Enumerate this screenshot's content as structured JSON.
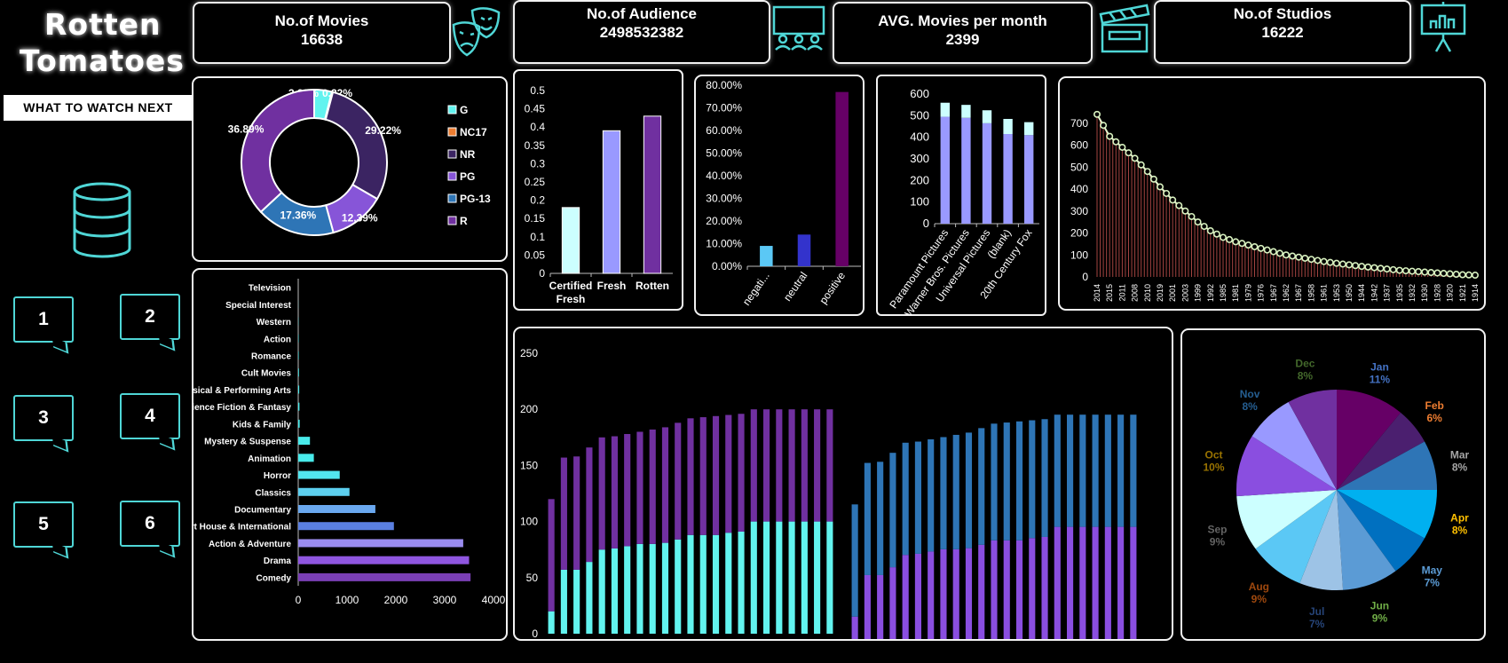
{
  "brand": {
    "line1": "Rotten",
    "line2": "Tomatoes",
    "tagline": "WHAT TO WATCH NEXT"
  },
  "kpis": [
    {
      "title": "No.of Movies",
      "value": "16638"
    },
    {
      "title": "No.of Audience",
      "value": "2498532382"
    },
    {
      "title": "AVG. Movies per month",
      "value": "2399"
    },
    {
      "title": "No.of Studios",
      "value": "16222"
    }
  ],
  "nav_buttons": [
    "1",
    "2",
    "3",
    "4",
    "5",
    "6"
  ],
  "colors": {
    "accent": "#4fd6d6",
    "panel_border": "#f2f2f2",
    "background": "#000000"
  },
  "icons": [
    "theater-masks-icon",
    "audience-icon",
    "clapperboard-icon",
    "presentation-icon",
    "database-icon"
  ],
  "chart_data": [
    {
      "type": "pie",
      "subtype": "donut",
      "categories": [
        "G",
        "NC17",
        "NR",
        "PG",
        "PG-13",
        "R"
      ],
      "values": [
        3.92,
        0.22,
        29.22,
        12.39,
        17.36,
        36.89
      ],
      "labels": [
        "3.92%",
        "0.22%",
        "29.22%",
        "12.39%",
        "17.36%",
        "36.89%"
      ],
      "colors": [
        "#62f3ef",
        "#ed7d31",
        "#3b2462",
        "#8755d8",
        "#2e75b6",
        "#7030a0"
      ],
      "legend": "right"
    },
    {
      "type": "bar",
      "categories": [
        "Certified Fresh",
        "Fresh",
        "Rotten"
      ],
      "values": [
        0.18,
        0.39,
        0.43
      ],
      "colors": [
        "#ccffff",
        "#9999ff",
        "#7030a0"
      ],
      "ylim": [
        0,
        0.5
      ],
      "yticks": [
        "0",
        "0.05",
        "0.1",
        "0.15",
        "0.2",
        "0.25",
        "0.3",
        "0.35",
        "0.4",
        "0.45",
        "0.5"
      ]
    },
    {
      "type": "bar",
      "categories": [
        "negati...",
        "neutral",
        "positive"
      ],
      "values": [
        9,
        14,
        77
      ],
      "colors": [
        "#5bc8f5",
        "#3333cc",
        "#660066"
      ],
      "ylim": [
        0,
        80
      ],
      "yticks": [
        "0.00%",
        "10.00%",
        "20.00%",
        "30.00%",
        "40.00%",
        "50.00%",
        "60.00%",
        "70.00%",
        "80.00%"
      ]
    },
    {
      "type": "bar",
      "stacked": true,
      "categories": [
        "Paramount Pictures",
        "Warner Bros. Pictures",
        "Universal Pictures",
        "(blank)",
        "20th Century Fox"
      ],
      "series": [
        {
          "values": [
            495,
            490,
            465,
            415,
            410
          ],
          "color": "#9999ff"
        },
        {
          "values": [
            65,
            60,
            60,
            70,
            60
          ],
          "color": "#ccffff"
        }
      ],
      "ylim": [
        0,
        600
      ],
      "yticks": [
        "0",
        "100",
        "200",
        "300",
        "400",
        "500",
        "600"
      ]
    },
    {
      "type": "line",
      "x": [
        "2014",
        "2015",
        "2011",
        "2008",
        "2010",
        "2019",
        "2001",
        "2003",
        "1999",
        "1992",
        "1985",
        "1981",
        "1979",
        "1976",
        "1967",
        "1962",
        "1967",
        "1958",
        "1961",
        "1953",
        "1950",
        "1944",
        "1942",
        "1937",
        "1935",
        "1932",
        "1930",
        "1928",
        "1920",
        "1921",
        "1914"
      ],
      "xticks": [
        "2014",
        "2015",
        "2011",
        "2008",
        "2010",
        "2019",
        "2001",
        "2003",
        "1999",
        "1992",
        "1985",
        "1981",
        "1979",
        "1976",
        "1967",
        "1962",
        "1967",
        "1958",
        "1961",
        "1953",
        "1950",
        "1944",
        "1942",
        "1937",
        "1935",
        "1932",
        "1930",
        "1928",
        "1920",
        "1921",
        "1914"
      ],
      "values": [
        740,
        640,
        590,
        540,
        480,
        410,
        350,
        300,
        250,
        210,
        180,
        160,
        145,
        130,
        115,
        100,
        90,
        80,
        70,
        62,
        55,
        48,
        42,
        36,
        30,
        26,
        22,
        18,
        14,
        10,
        8
      ],
      "ylim": [
        0,
        800
      ],
      "yticks": [
        "0",
        "100",
        "200",
        "300",
        "400",
        "500",
        "600",
        "700",
        "800"
      ]
    },
    {
      "type": "bar",
      "orientation": "horizontal",
      "categories": [
        "Television",
        "Special Interest",
        "Western",
        "Action",
        "Romance",
        "Cult Movies",
        "Musical & Performing Arts",
        "Science Fiction & Fantasy",
        "Kids & Family",
        "Mystery & Suspense",
        "Animation",
        "Horror",
        "Classics",
        "Documentary",
        "Art House & International",
        "Action & Adventure",
        "Drama",
        "Comedy"
      ],
      "values": [
        0,
        2,
        5,
        8,
        10,
        15,
        20,
        25,
        30,
        240,
        320,
        850,
        1050,
        1580,
        1960,
        3380,
        3500,
        3530
      ],
      "xlim": [
        0,
        4000
      ],
      "xticks": [
        "0",
        "1000",
        "2000",
        "3000",
        "4000"
      ]
    },
    {
      "type": "bar",
      "stacked": true,
      "series": [
        {
          "values": [
            20,
            57,
            57,
            64,
            75,
            76,
            78,
            80,
            80,
            81,
            84,
            88,
            88,
            88,
            90,
            91,
            100,
            100,
            100,
            100,
            100,
            100,
            100
          ],
          "color": "#62f3ef"
        },
        {
          "values": [
            100,
            100,
            101,
            102,
            100,
            100,
            100,
            100,
            102,
            103,
            104,
            104,
            105,
            106,
            105,
            105,
            100,
            100,
            100,
            100,
            100,
            100,
            100
          ],
          "color": "#7030a0"
        }
      ],
      "ylim": [
        0,
        250
      ],
      "yticks": [
        "0",
        "50",
        "100",
        "150",
        "200",
        "250"
      ]
    },
    {
      "type": "bar",
      "stacked": true,
      "series": [
        {
          "values": [
            20,
            57,
            57,
            64,
            75,
            76,
            78,
            80,
            80,
            81,
            84,
            88,
            88,
            88,
            90,
            91,
            100,
            100,
            100,
            100,
            100,
            100,
            100
          ],
          "color": "#8a4ee0"
        },
        {
          "values": [
            100,
            100,
            101,
            102,
            100,
            100,
            100,
            100,
            102,
            103,
            104,
            104,
            105,
            106,
            105,
            105,
            100,
            100,
            100,
            100,
            100,
            100,
            100
          ],
          "color": "#2e75b6"
        }
      ],
      "ylim": [
        0,
        250
      ],
      "yticks": [
        "0",
        "50",
        "100",
        "150",
        "200",
        "250"
      ]
    },
    {
      "type": "pie",
      "categories": [
        "Jan",
        "Feb",
        "Mar",
        "Apr",
        "May",
        "Jun",
        "Jul",
        "Aug",
        "Sep",
        "Oct",
        "Nov",
        "Dec"
      ],
      "values": [
        11,
        6,
        8,
        8,
        7,
        9,
        7,
        9,
        9,
        10,
        8,
        8
      ],
      "labels": [
        "11%",
        "6%",
        "8%",
        "8%",
        "7%",
        "9%",
        "7%",
        "9%",
        "9%",
        "10%",
        "8%",
        "8%"
      ],
      "colors": [
        "#660066",
        "#4b1f6f",
        "#2e75b6",
        "#00b0f0",
        "#0070c0",
        "#5b9bd5",
        "#9dc3e6",
        "#5bc8f5",
        "#ccffff",
        "#8a4ee0",
        "#9999ff",
        "#7030a0"
      ],
      "label_colors": [
        "#4472c4",
        "#ed7d31",
        "#a5a5a5",
        "#ffc000",
        "#5b9bd5",
        "#70ad47",
        "#264478",
        "#9e480e",
        "#636363",
        "#997300",
        "#255e91",
        "#43682b"
      ]
    }
  ]
}
